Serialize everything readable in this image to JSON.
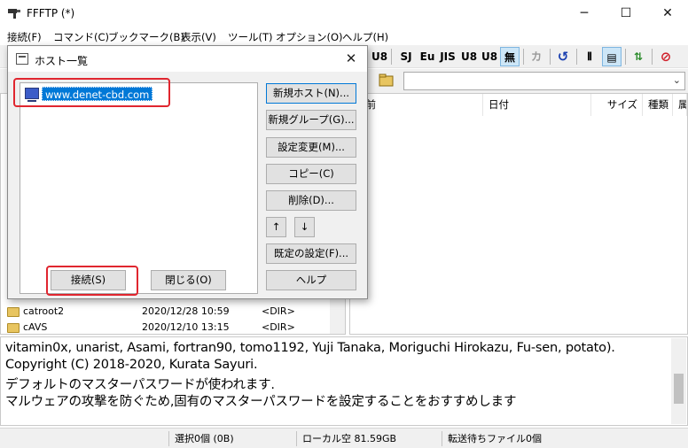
{
  "app": {
    "title": "FFFTP (*)"
  },
  "window_controls": {
    "minimize": "─",
    "maximize": "☐",
    "close": "✕"
  },
  "menu": [
    "接続(F)",
    "コマンド(C)",
    "ブックマーク(B)",
    "表示(V)",
    "ツール(T)",
    "オプション(O)",
    "ヘルプ(H)"
  ],
  "toolbar": {
    "buttons": [
      "U8",
      "SJ",
      "Eu",
      "JIS",
      "U8",
      "U8",
      "無",
      "カ",
      "↺",
      "⦀",
      "▤",
      "⇅",
      "⊘"
    ],
    "active": "無"
  },
  "remote_columns": [
    "名前",
    "日付",
    "サイズ",
    "種類",
    "属"
  ],
  "local_files": [
    {
      "name": "catroot2",
      "date": "2020/12/28 10:59",
      "size": "<DIR>"
    },
    {
      "name": "cAVS",
      "date": "2020/12/10 13:15",
      "size": "<DIR>"
    }
  ],
  "log": [
    "vitamin0x, unarist, Asami, fortran90, tomo1192, Yuji Tanaka, Moriguchi Hirokazu, Fu-sen, potato).",
    "Copyright (C) 2018-2020, Kurata Sayuri.",
    "デフォルトのマスターパスワードが使われます.",
    "マルウェアの攻撃を防ぐため,固有のマスターパスワードを設定することをおすすめします"
  ],
  "status": {
    "selection": "選択0個 (0B)",
    "local_free": "ローカル空 81.59GB",
    "queue": "転送待ちファイル0個"
  },
  "dialog": {
    "title": "ホスト一覧",
    "close": "✕",
    "hosts": [
      "www.denet-cbd.com"
    ],
    "buttons": {
      "new_host": "新規ホスト(N)...",
      "new_group": "新規グループ(G)...",
      "edit": "設定変更(M)...",
      "copy": "コピー(C)",
      "delete": "削除(D)...",
      "up": "↑",
      "down": "↓",
      "default": "既定の設定(F)...",
      "help": "ヘルプ",
      "connect": "接続(S)",
      "close": "閉じる(O)"
    }
  },
  "colors": {
    "highlight": "#e0262f",
    "selection": "#0078d7"
  }
}
